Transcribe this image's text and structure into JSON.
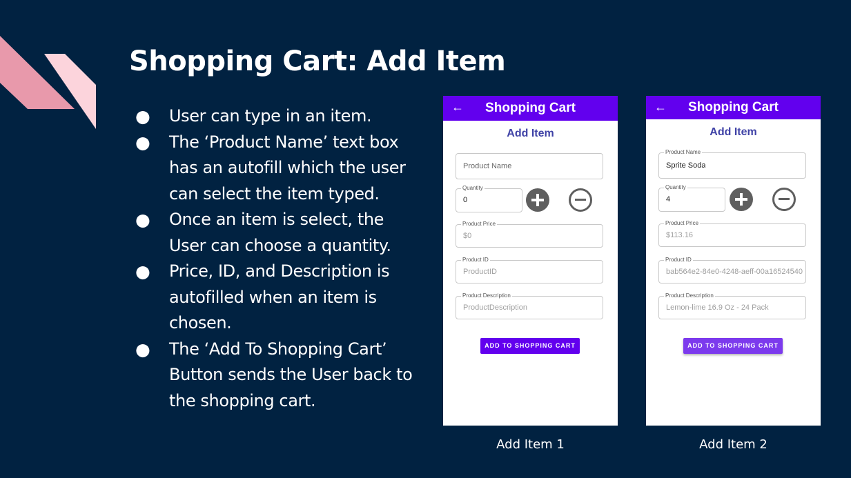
{
  "slide": {
    "title": "Shopping Cart: Add Item",
    "bullets": [
      "User can type in an item.",
      "The ‘Product Name’ text box has an autofill which the user can select the item typed.",
      "Once an item is select, the User can choose a quantity.",
      "Price, ID, and Description is autofilled when an item is chosen.",
      "The ‘Add To Shopping Cart’ Button sends the User back to the shopping cart."
    ],
    "bullet_glyph": "●"
  },
  "colors": {
    "background": "#012241",
    "appbar": "#6200ee",
    "heading": "#3f42a6",
    "button_1": "#6200ee",
    "button_2": "#7c3aed",
    "deco_pink": "#e899ab",
    "deco_light": "#fcd4dc"
  },
  "screens": [
    {
      "caption": "Add Item 1",
      "appbar_title": "Shopping Cart",
      "back_icon": "←",
      "heading": "Add Item",
      "product_name": {
        "label": "",
        "value": "Product Name"
      },
      "quantity": {
        "label": "Quantity",
        "value": "0"
      },
      "price": {
        "label": "Product Price",
        "value": "$0"
      },
      "product_id": {
        "label": "Product ID",
        "value": "ProductID"
      },
      "description": {
        "label": "Product Description",
        "value": "ProductDescription"
      },
      "add_button": "ADD TO SHOPPING CART"
    },
    {
      "caption": "Add Item 2",
      "appbar_title": "Shopping Cart",
      "back_icon": "←",
      "heading": "Add Item",
      "product_name": {
        "label": "Product Name",
        "value": "Sprite Soda"
      },
      "quantity": {
        "label": "Quantity",
        "value": "4"
      },
      "price": {
        "label": "Product Price",
        "value": "$113.16"
      },
      "product_id": {
        "label": "Product ID",
        "value": "bab564e2-84e0-4248-aeff-00a16524540"
      },
      "description": {
        "label": "Product Description",
        "value": "Lemon-lime 16.9 Oz - 24 Pack"
      },
      "add_button": "ADD TO SHOPPING CART"
    }
  ]
}
